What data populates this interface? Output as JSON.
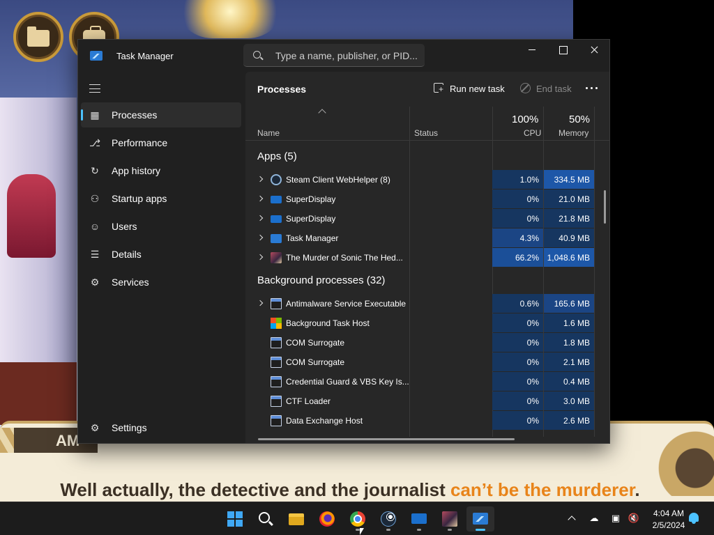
{
  "game": {
    "speaker_tag": "AM",
    "dialog_text": "Well actually, the detective and the journalist ",
    "dialog_highlight": "can’t be the murderer",
    "dialog_end": "."
  },
  "window": {
    "title": "Task Manager",
    "search_placeholder": "Type a name, publisher, or PID..."
  },
  "sidebar": {
    "items": [
      {
        "label": "Processes",
        "icon": "processes-icon"
      },
      {
        "label": "Performance",
        "icon": "performance-icon"
      },
      {
        "label": "App history",
        "icon": "app-history-icon"
      },
      {
        "label": "Startup apps",
        "icon": "startup-apps-icon"
      },
      {
        "label": "Users",
        "icon": "users-icon"
      },
      {
        "label": "Details",
        "icon": "details-icon"
      },
      {
        "label": "Services",
        "icon": "services-icon"
      }
    ],
    "settings_label": "Settings"
  },
  "main": {
    "title": "Processes",
    "run_new_task": "Run new task",
    "end_task": "End task",
    "columns": {
      "name": "Name",
      "status": "Status",
      "cpu_pct": "100%",
      "cpu": "CPU",
      "memory_pct": "50%",
      "memory": "Memory"
    },
    "apps_group": "Apps (5)",
    "apps": [
      {
        "name": "Steam Client WebHelper (8)",
        "cpu": "1.0%",
        "memory": "334.5 MB",
        "icon": "steam"
      },
      {
        "name": "SuperDisplay",
        "cpu": "0%",
        "memory": "21.0 MB",
        "icon": "display"
      },
      {
        "name": "SuperDisplay",
        "cpu": "0%",
        "memory": "21.8 MB",
        "icon": "display"
      },
      {
        "name": "Task Manager",
        "cpu": "4.3%",
        "memory": "40.9 MB",
        "icon": "tm"
      },
      {
        "name": "The Murder of Sonic The Hed...",
        "cpu": "66.2%",
        "memory": "1,048.6 MB",
        "icon": "game"
      }
    ],
    "background_group": "Background processes (32)",
    "background": [
      {
        "name": "Antimalware Service Executable",
        "cpu": "0.6%",
        "memory": "165.6 MB",
        "icon": "exe",
        "expandable": true
      },
      {
        "name": "Background Task Host",
        "cpu": "0%",
        "memory": "1.6 MB",
        "icon": "bth",
        "expandable": false
      },
      {
        "name": "COM Surrogate",
        "cpu": "0%",
        "memory": "1.8 MB",
        "icon": "exe",
        "expandable": false
      },
      {
        "name": "COM Surrogate",
        "cpu": "0%",
        "memory": "2.1 MB",
        "icon": "exe",
        "expandable": false
      },
      {
        "name": "Credential Guard & VBS Key Is...",
        "cpu": "0%",
        "memory": "0.4 MB",
        "icon": "exe",
        "expandable": false
      },
      {
        "name": "CTF Loader",
        "cpu": "0%",
        "memory": "3.0 MB",
        "icon": "exe",
        "expandable": false
      },
      {
        "name": "Data Exchange Host",
        "cpu": "0%",
        "memory": "2.6 MB",
        "icon": "exe",
        "expandable": false
      }
    ]
  },
  "taskbar": {
    "time": "4:04 AM",
    "date": "2/5/2024",
    "apps": [
      "start",
      "search",
      "file-explorer",
      "firefox",
      "chrome",
      "steam",
      "superdisplay",
      "the-murder-of-sonic",
      "task-manager"
    ]
  },
  "colors": {
    "accent": "#4cc2ff",
    "highlight_text": "#e8841a"
  }
}
